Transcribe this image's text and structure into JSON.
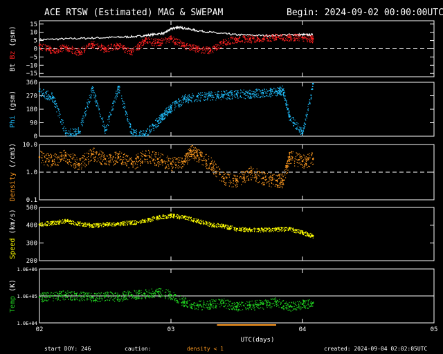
{
  "header": {
    "title": "ACE RTSW (Estimated) MAG & SWEPAM",
    "begin_label": "Begin: 2024-09-02 00:00:00UTC"
  },
  "footer": {
    "start_doy": "start DOY: 246",
    "caution": "caution:",
    "density_note": "density < 1",
    "created": "created: 2024-09-04 02:02:05UTC"
  },
  "chart_data": {
    "type": "scatter",
    "x_axis": {
      "label": "UTC(days)",
      "range": [
        2,
        5
      ],
      "ticks": [
        2,
        3,
        4,
        5
      ],
      "tick_labels": [
        "02",
        "03",
        "04",
        "05"
      ],
      "data_end": 4.08
    },
    "panels": [
      {
        "id": "mag",
        "ylabel_parts": [
          {
            "text": "Bt",
            "color": "#ffffff"
          },
          {
            "text": " Bz",
            "color": "#ff2020"
          },
          {
            "text": " (gsm)",
            "color": "#ffffff"
          }
        ],
        "ylim": [
          -17,
          17
        ],
        "scale": "linear",
        "ticks": [
          15,
          10,
          5,
          0,
          -5,
          -10,
          -15
        ],
        "tick_labels": [
          "15",
          "10",
          "5",
          "0",
          "−5",
          "−10",
          "−15"
        ],
        "zero_dashed": true,
        "series": [
          {
            "name": "Bt",
            "color": "#ffffff",
            "style": "line",
            "x": [
              2.0,
              2.2,
              2.4,
              2.6,
              2.75,
              2.85,
              2.95,
              3.0,
              3.05,
              3.1,
              3.2,
              3.35,
              3.5,
              3.7,
              3.9,
              4.0,
              4.08
            ],
            "y": [
              5.5,
              6.0,
              6.5,
              7.0,
              7.5,
              8.5,
              9.5,
              12,
              13,
              12.5,
              11,
              9.5,
              8.5,
              8.0,
              8.5,
              8.5,
              8.5
            ]
          },
          {
            "name": "Bz",
            "color": "#ff2020",
            "style": "dots",
            "x": [
              2.0,
              2.1,
              2.2,
              2.3,
              2.4,
              2.5,
              2.6,
              2.7,
              2.8,
              2.9,
              3.0,
              3.1,
              3.2,
              3.3,
              3.4,
              3.5,
              3.6,
              3.7,
              3.8,
              3.9,
              4.0,
              4.08
            ],
            "y": [
              2,
              -1,
              1,
              -2,
              3,
              0,
              2,
              -2,
              5,
              4,
              6,
              2,
              0,
              -1,
              4,
              6,
              6,
              6,
              7,
              7,
              7,
              6
            ]
          }
        ]
      },
      {
        "id": "phi",
        "ylabel_parts": [
          {
            "text": "Phi",
            "color": "#20c0ff"
          },
          {
            "text": " (gsm)",
            "color": "#ffffff"
          }
        ],
        "ylim": [
          0,
          360
        ],
        "scale": "linear",
        "ticks": [
          360,
          270,
          180,
          90,
          0
        ],
        "tick_labels": [
          "360",
          "270",
          "180",
          "90",
          "0"
        ],
        "series": [
          {
            "name": "Phi",
            "color": "#20c0ff",
            "style": "dots",
            "x": [
              2.0,
              2.1,
              2.2,
              2.3,
              2.4,
              2.5,
              2.6,
              2.7,
              2.8,
              2.9,
              2.95,
              3.0,
              3.1,
              3.2,
              3.3,
              3.4,
              3.5,
              3.6,
              3.7,
              3.8,
              3.85,
              3.9,
              4.0,
              4.08
            ],
            "y": [
              300,
              260,
              20,
              30,
              320,
              40,
              330,
              20,
              10,
              100,
              150,
              190,
              250,
              265,
              270,
              275,
              280,
              285,
              290,
              300,
              310,
              130,
              20,
              350
            ]
          }
        ]
      },
      {
        "id": "density",
        "ylabel_parts": [
          {
            "text": "Density",
            "color": "#ff9a20"
          },
          {
            "text": " (/cm3)",
            "color": "#ffffff"
          }
        ],
        "ylim": [
          0.1,
          10
        ],
        "scale": "log",
        "ticks": [
          10,
          1,
          0.1
        ],
        "tick_labels": [
          "10.0",
          "1.0",
          "0.1"
        ],
        "ref_dashed": 1.0,
        "series": [
          {
            "name": "Density",
            "color": "#ff9a20",
            "style": "dots",
            "x": [
              2.0,
              2.1,
              2.2,
              2.3,
              2.4,
              2.5,
              2.6,
              2.7,
              2.8,
              2.9,
              3.0,
              3.1,
              3.15,
              3.2,
              3.3,
              3.4,
              3.5,
              3.6,
              3.7,
              3.8,
              3.85,
              3.9,
              4.0,
              4.08
            ],
            "y": [
              3.5,
              2.5,
              4.0,
              2.0,
              4.5,
              3.0,
              3.5,
              2.0,
              4.0,
              3.0,
              2.0,
              2.5,
              6.0,
              4.0,
              2.0,
              0.6,
              0.5,
              1.0,
              0.6,
              0.5,
              0.5,
              3.5,
              2.5,
              3.0
            ]
          }
        ]
      },
      {
        "id": "speed",
        "ylabel_parts": [
          {
            "text": "Speed",
            "color": "#ffff00"
          },
          {
            "text": " (km/s)",
            "color": "#ffffff"
          }
        ],
        "ylim": [
          200,
          500
        ],
        "scale": "linear",
        "ticks": [
          500,
          400,
          300,
          200
        ],
        "tick_labels": [
          "500",
          "400",
          "300",
          "200"
        ],
        "series": [
          {
            "name": "Speed",
            "color": "#ffff00",
            "style": "dots",
            "x": [
              2.0,
              2.1,
              2.2,
              2.3,
              2.4,
              2.5,
              2.6,
              2.7,
              2.8,
              2.9,
              3.0,
              3.1,
              3.2,
              3.3,
              3.4,
              3.5,
              3.6,
              3.7,
              3.8,
              3.9,
              4.0,
              4.08
            ],
            "y": [
              405,
              415,
              425,
              410,
              400,
              405,
              410,
              415,
              425,
              445,
              455,
              445,
              425,
              405,
              395,
              380,
              375,
              375,
              378,
              380,
              360,
              340
            ]
          }
        ]
      },
      {
        "id": "temp",
        "ylabel_parts": [
          {
            "text": "Temp",
            "color": "#20d020"
          },
          {
            "text": " (K)",
            "color": "#ffffff"
          }
        ],
        "ylim": [
          10000,
          1000000
        ],
        "scale": "log",
        "ticks": [
          1000000,
          100000,
          10000
        ],
        "tick_labels": [
          "1.0E+06",
          "1.0E+05",
          "1.0E+04"
        ],
        "ref_line": 100000,
        "series": [
          {
            "name": "Temp",
            "color": "#20d020",
            "style": "dots",
            "x": [
              2.0,
              2.1,
              2.2,
              2.3,
              2.4,
              2.5,
              2.6,
              2.7,
              2.8,
              2.9,
              3.0,
              3.1,
              3.2,
              3.3,
              3.4,
              3.5,
              3.6,
              3.7,
              3.8,
              3.9,
              4.0,
              4.08
            ],
            "y": [
              90000,
              100000,
              110000,
              100000,
              90000,
              100000,
              95000,
              110000,
              120000,
              140000,
              110000,
              60000,
              45000,
              50000,
              55000,
              40000,
              45000,
              50000,
              60000,
              40000,
              50000,
              55000
            ]
          }
        ]
      }
    ]
  }
}
